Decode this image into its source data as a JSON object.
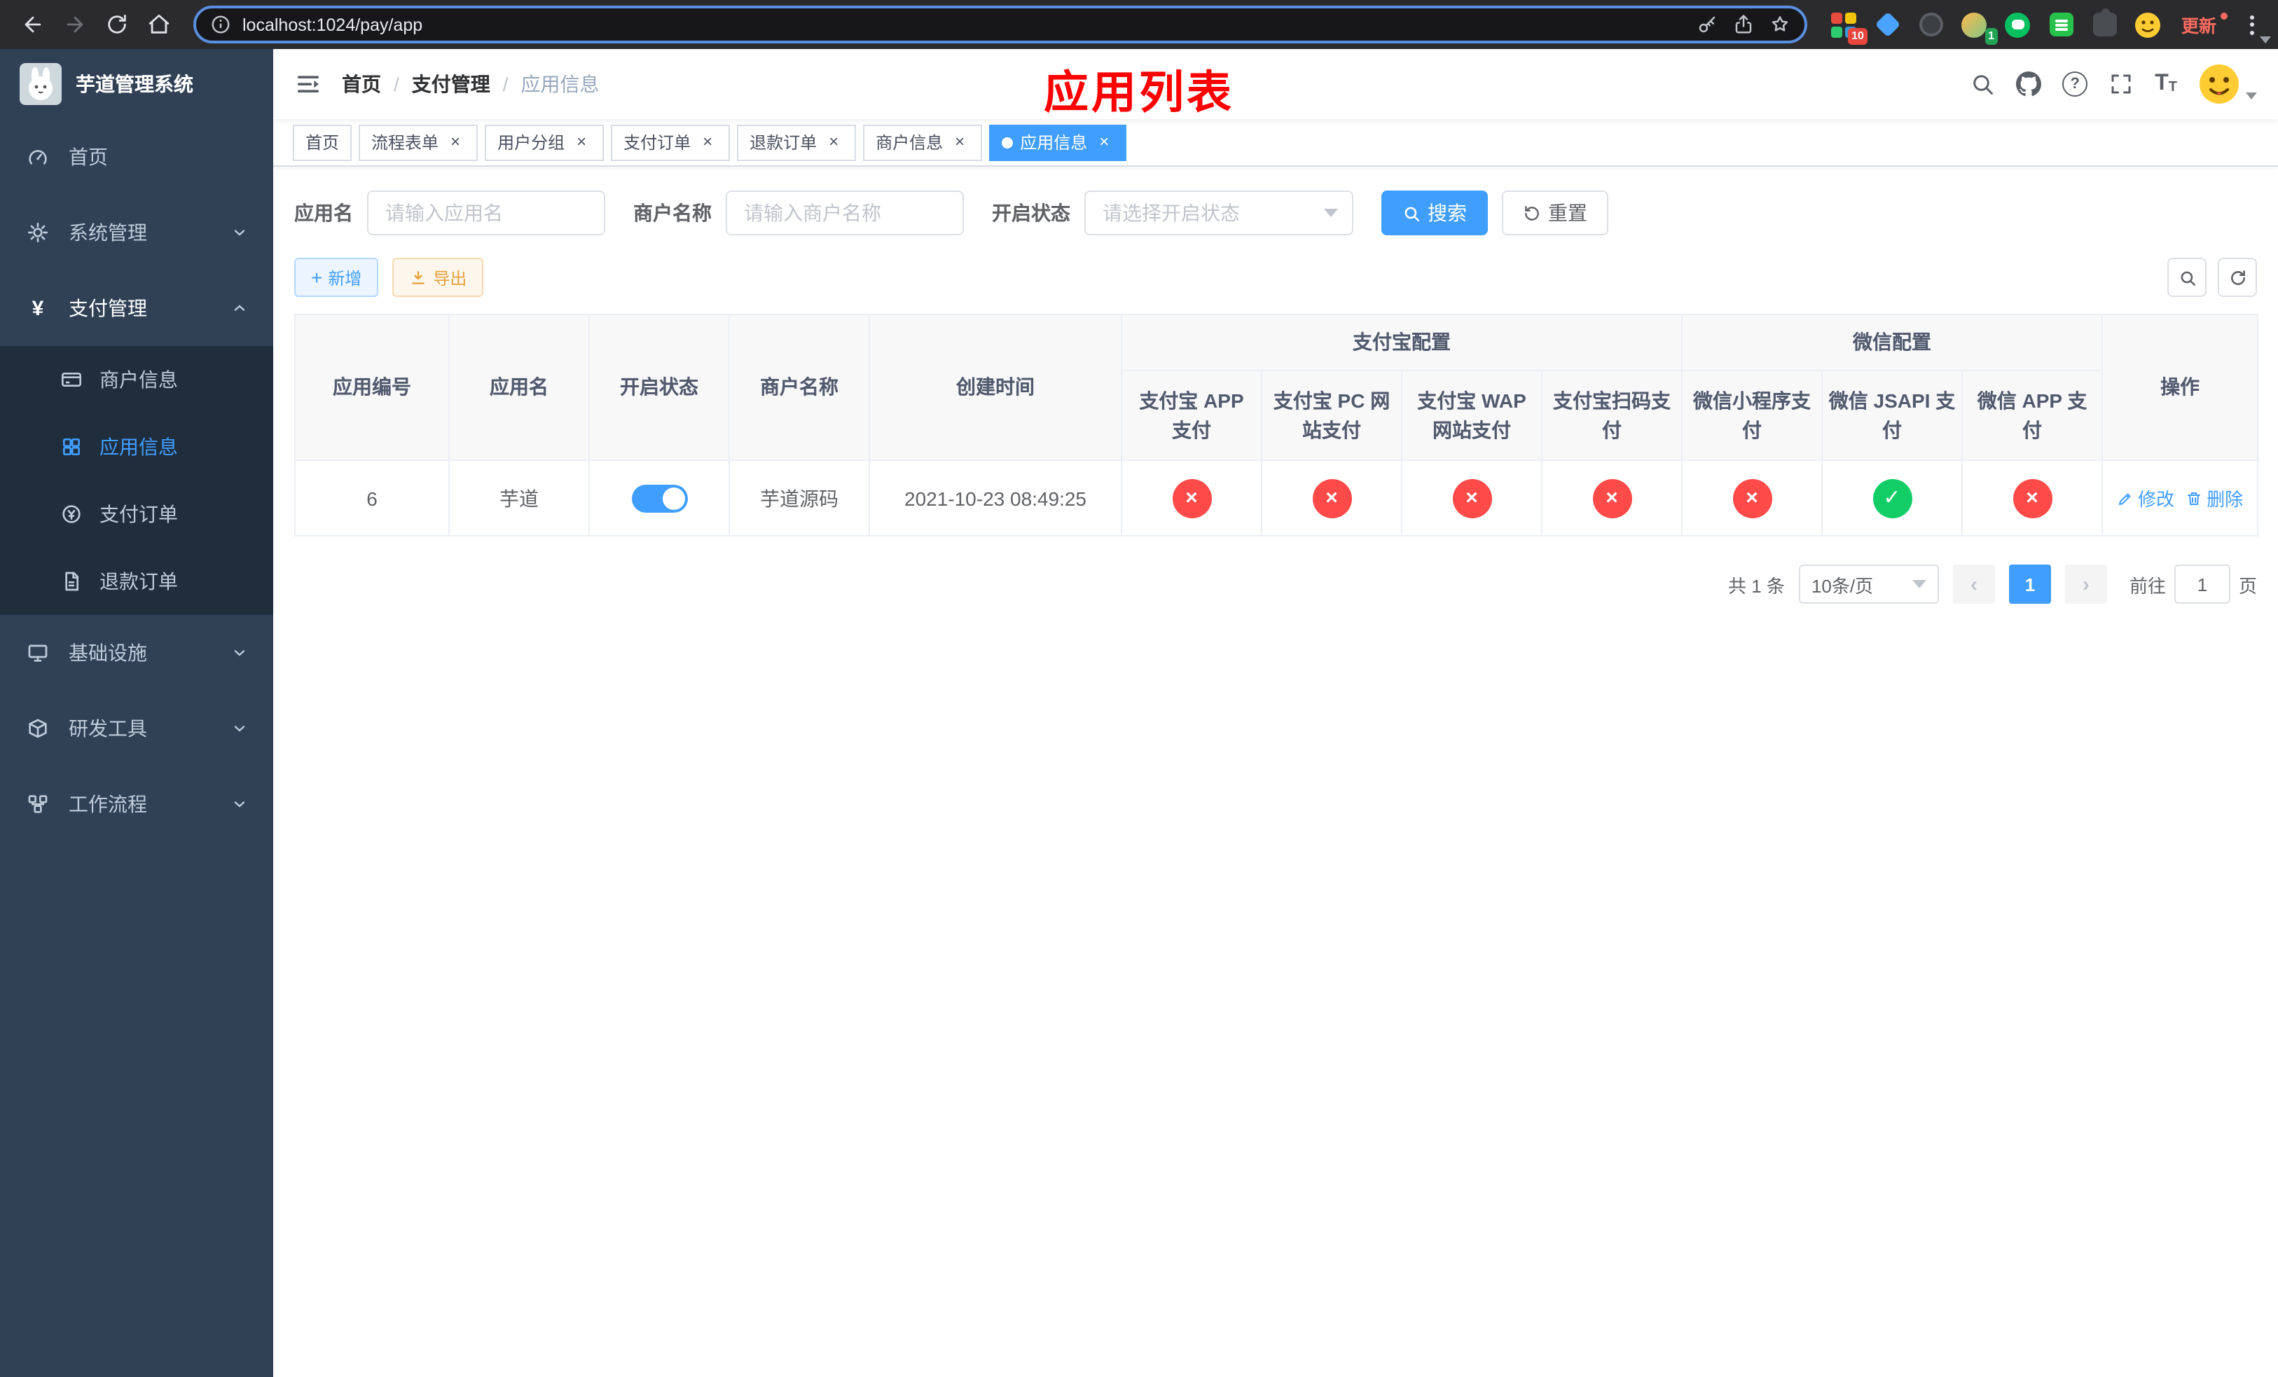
{
  "colors": {
    "primary": "#409eff",
    "danger": "#ff4a4a",
    "success": "#13ce66",
    "warning": "#e6a23c",
    "title-red": "#ff0000",
    "sidebar-bg": "#304156",
    "submenu-bg": "#1f2d3d"
  },
  "symbols": {
    "close": "×",
    "check": "✓",
    "cross": "×",
    "plus": "+",
    "prev": "‹",
    "next": "›",
    "slash": "/",
    "question": "?",
    "yen": "¥",
    "font_big": "T",
    "font_small": "T"
  },
  "browser": {
    "url": "localhost:1024/pay/app",
    "update_label": "更新",
    "ext_badge_grid": "10",
    "ext_badge_avatar": "1"
  },
  "sidebar": {
    "title": "芋道管理系统",
    "menu": [
      {
        "label": "首页"
      },
      {
        "label": "系统管理"
      },
      {
        "label": "支付管理"
      },
      {
        "label": "基础设施"
      },
      {
        "label": "研发工具"
      },
      {
        "label": "工作流程"
      }
    ],
    "submenu": [
      {
        "label": "商户信息"
      },
      {
        "label": "应用信息"
      },
      {
        "label": "支付订单"
      },
      {
        "label": "退款订单"
      }
    ]
  },
  "navbar": {
    "breadcrumb": [
      "首页",
      "支付管理",
      "应用信息"
    ],
    "page_title": "应用列表"
  },
  "tabs": [
    {
      "label": "首页"
    },
    {
      "label": "流程表单"
    },
    {
      "label": "用户分组"
    },
    {
      "label": "支付订单"
    },
    {
      "label": "退款订单"
    },
    {
      "label": "商户信息"
    },
    {
      "label": "应用信息"
    }
  ],
  "filters": {
    "app_name_label": "应用名",
    "app_name_placeholder": "请输入应用名",
    "merchant_label": "商户名称",
    "merchant_placeholder": "请输入商户名称",
    "status_label": "开启状态",
    "status_placeholder": "请选择开启状态",
    "search_label": "搜索",
    "reset_label": "重置"
  },
  "toolbar": {
    "add_label": "新增",
    "export_label": "导出"
  },
  "table": {
    "group_alipay": "支付宝配置",
    "group_wechat": "微信配置",
    "columns": {
      "id": "应用编号",
      "name": "应用名",
      "status": "开启状态",
      "merchant": "商户名称",
      "created": "创建时间",
      "ops": "操作"
    },
    "alipay_cols": [
      "支付宝 APP 支付",
      "支付宝 PC 网站支付",
      "支付宝 WAP 网站支付",
      "支付宝扫码支付"
    ],
    "wechat_cols": [
      "微信小程序支付",
      "微信 JSAPI 支付",
      "微信 APP 支付"
    ],
    "rows": [
      {
        "id": "6",
        "name": "芋道",
        "enabled": true,
        "merchant": "芋道源码",
        "created": "2021-10-23 08:49:25",
        "statuses": [
          "no",
          "no",
          "no",
          "no",
          "no",
          "yes",
          "no"
        ],
        "edit_label": "修改",
        "delete_label": "删除"
      }
    ]
  },
  "pagination": {
    "total_text": "共 1 条",
    "page_size": "10条/页",
    "current_page": "1",
    "goto_label": "前往",
    "goto_value": "1",
    "goto_suffix": "页"
  }
}
